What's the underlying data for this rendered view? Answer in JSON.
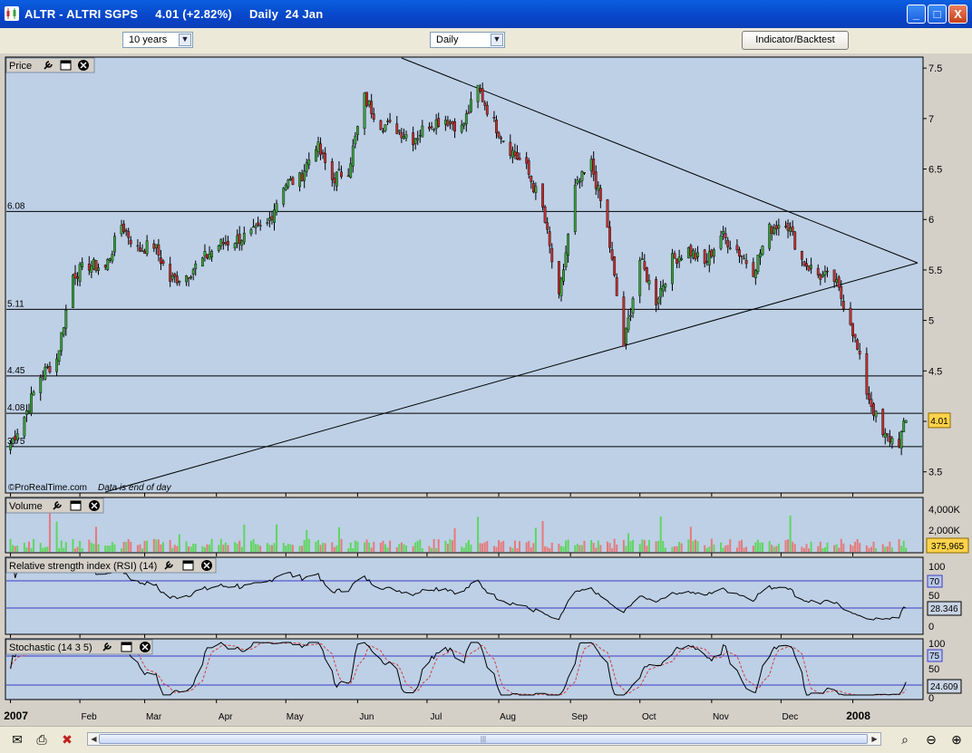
{
  "window": {
    "title": "ALTR - ALTRI SGPS",
    "quote": "4.01 (+2.82%)",
    "period": "Daily  24 Jan",
    "min_label": "_",
    "max_label": "□",
    "close_label": "X"
  },
  "toolbar": {
    "range_value": "10 years",
    "interval_value": "Daily",
    "indicator_button": "Indicator/Backtest"
  },
  "colors": {
    "chart_bg": "#bdd0e6",
    "up_candle": "#3ca03c",
    "down_candle": "#c03030",
    "vol_up": "#5ed65e",
    "vol_down": "#e67a7a",
    "signal_line": "#d04040",
    "level_line": "#3b3bc8",
    "current_price_bg": "#ffd24a"
  },
  "panels": {
    "price": {
      "title": "Price",
      "watermark": "©ProRealTime.com",
      "watermark_note": "Data is end of day",
      "current_value": "4.01"
    },
    "volume": {
      "title": "Volume",
      "current_value": "375,965"
    },
    "rsi": {
      "title": "Relative strength index (RSI) (14)",
      "current_value": "28.346",
      "level_high": "70"
    },
    "stochastic": {
      "title": "Stochastic (14 3 5)",
      "current_value": "24.609",
      "level_high": "75"
    }
  },
  "chart_data": [
    {
      "type": "candlestick",
      "title": "Price",
      "ylim": [
        3.3,
        7.6
      ],
      "y_ticks": [
        "7.5",
        "7",
        "6.5",
        "6",
        "5.5",
        "5",
        "4.5",
        "4",
        "3.5"
      ],
      "x_tick_labels": [
        "2007",
        "Feb",
        "Mar",
        "Apr",
        "May",
        "Jun",
        "Jul",
        "Aug",
        "Sep",
        "Oct",
        "Nov",
        "Dec",
        "2008"
      ],
      "horizontal_levels": [
        {
          "label": "6.08",
          "value": 6.08
        },
        {
          "label": "5.11",
          "value": 5.11
        },
        {
          "label": "4.45",
          "value": 4.45
        },
        {
          "label": "4.08",
          "value": 4.08
        },
        {
          "label": "3.75",
          "value": 3.75
        }
      ],
      "close_series": [
        {
          "date": "2007-01-02",
          "close": 3.78
        },
        {
          "date": "2007-01-08",
          "close": 4.05
        },
        {
          "date": "2007-01-15",
          "close": 4.45
        },
        {
          "date": "2007-01-22",
          "close": 4.62
        },
        {
          "date": "2007-01-29",
          "close": 5.45
        },
        {
          "date": "2007-02-05",
          "close": 5.55
        },
        {
          "date": "2007-02-12",
          "close": 5.52
        },
        {
          "date": "2007-02-19",
          "close": 5.95
        },
        {
          "date": "2007-02-26",
          "close": 5.7
        },
        {
          "date": "2007-03-05",
          "close": 5.75
        },
        {
          "date": "2007-03-12",
          "close": 5.4
        },
        {
          "date": "2007-03-19",
          "close": 5.45
        },
        {
          "date": "2007-03-26",
          "close": 5.6
        },
        {
          "date": "2007-04-02",
          "close": 5.75
        },
        {
          "date": "2007-04-09",
          "close": 5.8
        },
        {
          "date": "2007-04-16",
          "close": 5.85
        },
        {
          "date": "2007-04-23",
          "close": 5.95
        },
        {
          "date": "2007-04-30",
          "close": 6.35
        },
        {
          "date": "2007-05-07",
          "close": 6.4
        },
        {
          "date": "2007-05-14",
          "close": 6.75
        },
        {
          "date": "2007-05-21",
          "close": 6.4
        },
        {
          "date": "2007-05-28",
          "close": 6.5
        },
        {
          "date": "2007-06-04",
          "close": 7.2
        },
        {
          "date": "2007-06-11",
          "close": 6.95
        },
        {
          "date": "2007-06-18",
          "close": 6.9
        },
        {
          "date": "2007-06-25",
          "close": 6.8
        },
        {
          "date": "2007-07-02",
          "close": 6.95
        },
        {
          "date": "2007-07-09",
          "close": 7.0
        },
        {
          "date": "2007-07-16",
          "close": 6.9
        },
        {
          "date": "2007-07-23",
          "close": 7.3
        },
        {
          "date": "2007-07-30",
          "close": 6.95
        },
        {
          "date": "2007-08-06",
          "close": 6.7
        },
        {
          "date": "2007-08-13",
          "close": 6.5
        },
        {
          "date": "2007-08-20",
          "close": 6.1
        },
        {
          "date": "2007-08-27",
          "close": 5.2
        },
        {
          "date": "2007-09-03",
          "close": 6.3
        },
        {
          "date": "2007-09-10",
          "close": 6.55
        },
        {
          "date": "2007-09-17",
          "close": 5.9
        },
        {
          "date": "2007-09-24",
          "close": 4.75
        },
        {
          "date": "2007-10-01",
          "close": 5.6
        },
        {
          "date": "2007-10-08",
          "close": 5.2
        },
        {
          "date": "2007-10-15",
          "close": 5.6
        },
        {
          "date": "2007-10-22",
          "close": 5.7
        },
        {
          "date": "2007-10-29",
          "close": 5.55
        },
        {
          "date": "2007-11-05",
          "close": 5.85
        },
        {
          "date": "2007-11-12",
          "close": 5.7
        },
        {
          "date": "2007-11-19",
          "close": 5.5
        },
        {
          "date": "2007-11-26",
          "close": 5.9
        },
        {
          "date": "2007-12-03",
          "close": 6.0
        },
        {
          "date": "2007-12-10",
          "close": 5.6
        },
        {
          "date": "2007-12-17",
          "close": 5.45
        },
        {
          "date": "2007-12-24",
          "close": 5.4
        },
        {
          "date": "2007-12-31",
          "close": 5.0
        },
        {
          "date": "2008-01-07",
          "close": 4.3
        },
        {
          "date": "2008-01-14",
          "close": 3.85
        },
        {
          "date": "2008-01-21",
          "close": 3.8
        },
        {
          "date": "2008-01-24",
          "close": 4.01
        }
      ],
      "trendlines": [
        {
          "from": {
            "date": "2007-06-20",
            "price": 7.6
          },
          "to": {
            "date": "2008-01-29",
            "price": 5.57
          }
        },
        {
          "from": {
            "date": "2007-02-12",
            "price": 3.3
          },
          "to": {
            "date": "2008-01-29",
            "price": 5.57
          }
        }
      ]
    },
    {
      "type": "bar",
      "title": "Volume",
      "ylim": [
        0,
        5000000
      ],
      "y_ticks": [
        "4,000K",
        "2,000K"
      ],
      "last_value": 375965
    },
    {
      "type": "line",
      "title": "Relative strength index (RSI) (14)",
      "ylim": [
        0,
        100
      ],
      "y_ticks": [
        "100",
        "50",
        "0"
      ],
      "levels": [
        70,
        30
      ],
      "last_value": 28.346
    },
    {
      "type": "line",
      "title": "Stochastic (14 3 5)",
      "ylim": [
        0,
        100
      ],
      "y_ticks": [
        "100",
        "50",
        "0"
      ],
      "levels": [
        75,
        25
      ],
      "last_value": 24.609
    }
  ]
}
